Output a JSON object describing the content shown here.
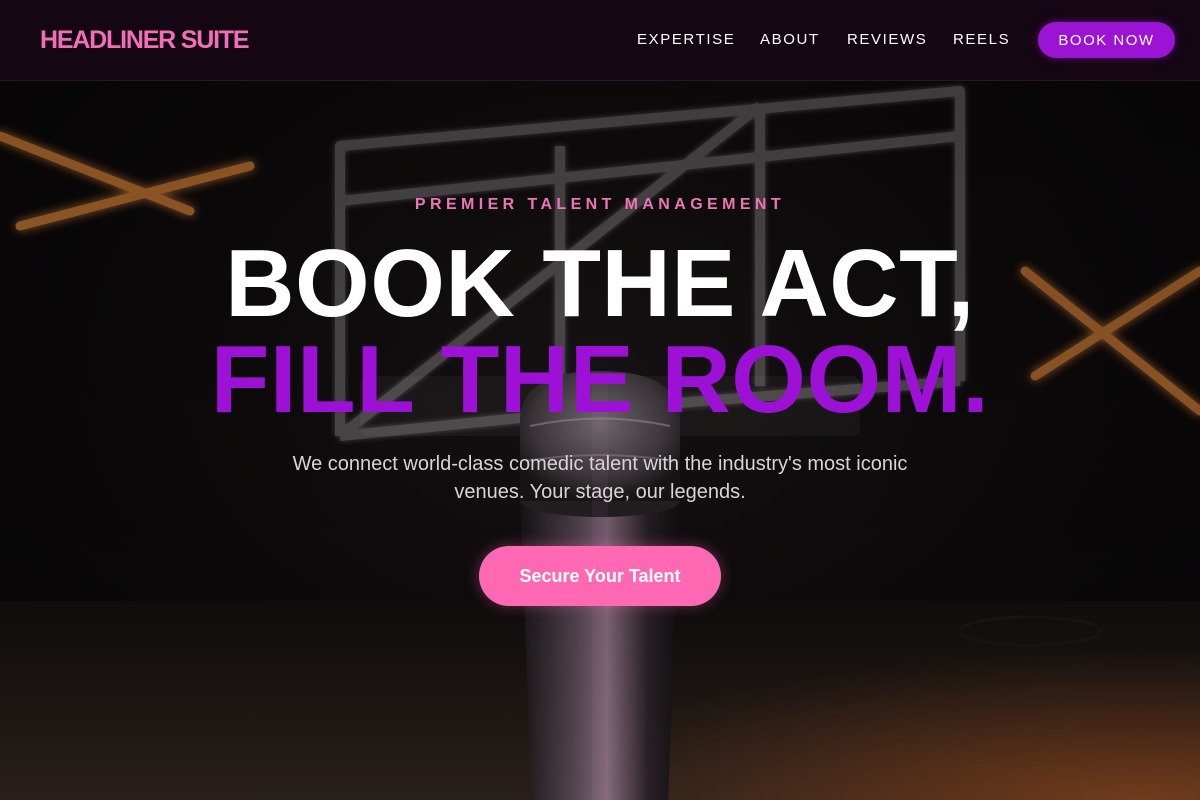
{
  "brand": {
    "name": "HEADLINER SUITE"
  },
  "nav": {
    "links": [
      "EXPERTISE",
      "ABOUT",
      "REVIEWS",
      "REELS"
    ],
    "cta_label": "BOOK NOW"
  },
  "hero": {
    "eyebrow": "PREMIER TALENT MANAGEMENT",
    "headline_line1": "BOOK THE ACT,",
    "headline_line2": "FILL THE ROOM.",
    "subtext": "We connect world-class comedic talent with the industry's most iconic venues. Your stage, our legends.",
    "cta_label": "Secure Your Talent",
    "background_image": "microphone-on-stage-with-neon-lights"
  },
  "colors": {
    "brand_pink": "#f26fb7",
    "accent_purple": "#9b13d4",
    "cta_pink": "#ff69b4",
    "nav_background": "#140612"
  }
}
